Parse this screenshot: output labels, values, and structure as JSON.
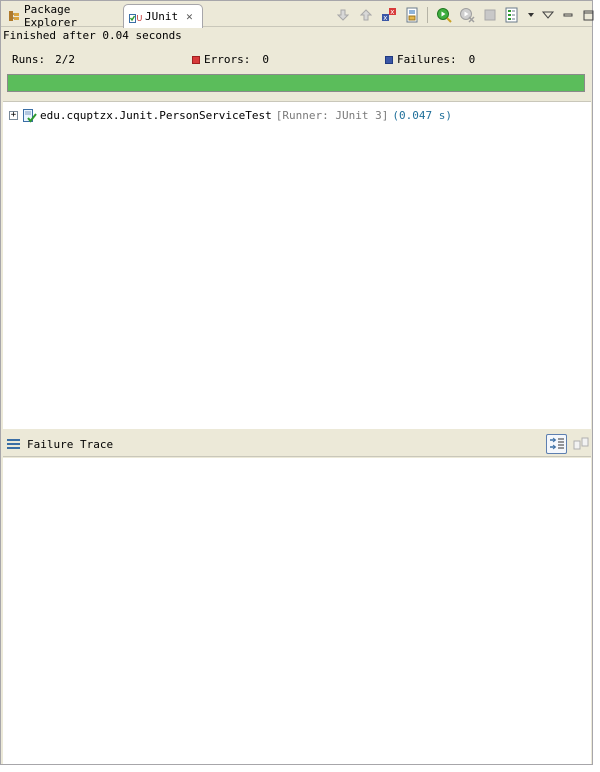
{
  "tabs": [
    {
      "label": "Package Explorer",
      "icon": "package-explorer-icon",
      "active": false
    },
    {
      "label": "JUnit",
      "icon": "junit-icon",
      "active": true
    }
  ],
  "toolbar": {
    "icons": [
      "next-failure-icon",
      "previous-failure-icon",
      "show-failures-only-icon",
      "scroll-lock-icon",
      "rerun-test-icon",
      "rerun-failed-first-icon",
      "stop-icon",
      "test-run-history-icon",
      "view-menu-icon",
      "minimize-icon",
      "maximize-icon"
    ]
  },
  "status": {
    "message": "Finished after 0.04 seconds"
  },
  "counters": {
    "runs_label": "Runs:",
    "runs_value": "2/2",
    "errors_label": "Errors:",
    "errors_value": "0",
    "failures_label": "Failures:",
    "failures_value": "0"
  },
  "progress": {
    "fraction": 1.0,
    "color": "#5bbd5b"
  },
  "tree": {
    "items": [
      {
        "name": "edu.cquptzx.Junit.PersonServiceTest",
        "runner": "[Runner: JUnit 3]",
        "elapsed": "(0.047 s)",
        "expanded": false
      }
    ]
  },
  "failure_trace": {
    "title": "Failure Trace",
    "buttons": [
      "filter-stack-trace-icon",
      "compare-result-icon"
    ]
  },
  "colors": {
    "chrome": "#ece9d8",
    "success": "#5bbd5b",
    "error_mark": "#d83a3a",
    "failure_mark": "#3a56a6",
    "elapsed_text": "#1f6f9a",
    "runner_text": "#7a7a7a"
  }
}
